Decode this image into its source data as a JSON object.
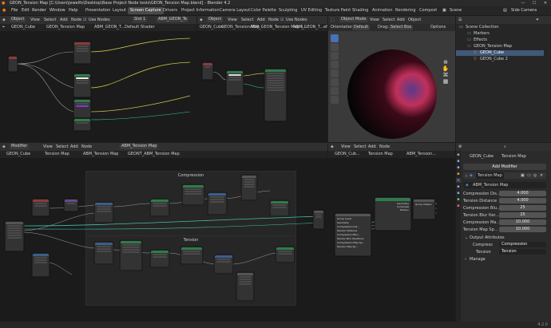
{
  "window": {
    "title": "GEON_Tension Map [C:\\Users\\jewelfo\\Desktop\\Base Project Node tests\\GEON_Tension Map.blend] - Blender 4.2",
    "minimize": "—",
    "maximize": "☐",
    "close": "✕"
  },
  "menu": {
    "items": [
      "File",
      "Edit",
      "Render",
      "Window",
      "Help"
    ],
    "workspaces": [
      "Presentation",
      "Layout",
      "Screen Capture",
      "Drivers",
      "Project Information",
      "Camera Layout",
      "Color Palette",
      "Sculpting",
      "UV Editing",
      "Texture Paint",
      "Shading",
      "Animation",
      "Rendering",
      "Compost"
    ],
    "active_workspace": "Screen Capture",
    "scene_label": "Scene",
    "view_layer_label": "Side Camera"
  },
  "shader_left": {
    "header": [
      "Object",
      "View",
      "Select",
      "Add",
      "Node",
      "Use Nodes",
      "Slot 1",
      "ABM_GEON_Te"
    ],
    "breadcrumb": [
      "GEON_Cube",
      "GEON_Tension Map",
      "ABM_GEON_T...Default Shader"
    ]
  },
  "shader_mid": {
    "header": [
      "Object",
      "View",
      "Select",
      "Add",
      "Node",
      "Use Nodes"
    ],
    "breadcrumb": [
      "GEON_Cube",
      "GEON_Tension Map",
      "ABM_GEON_Tension Map S...",
      "ABM_GEON_T...efault Shader"
    ]
  },
  "viewport": {
    "header": [
      "Object Mode",
      "View",
      "Select",
      "Add",
      "Object"
    ],
    "sub": [
      "Orientation:",
      "Default",
      "Drag:",
      "Select Box",
      "Options"
    ]
  },
  "outliner": {
    "title": "Scene Collection",
    "rows": [
      "Markers",
      "Effects",
      "GEON_Tension Map",
      "GEON_Cube",
      "GEON_Cube 2"
    ]
  },
  "geo_left": {
    "header": [
      "Modifier",
      "View",
      "Select",
      "Add",
      "Node",
      "ABM_Tension Map"
    ],
    "breadcrumb": [
      "GEON_Cube",
      "Tension Map",
      "ABM_Tension Map",
      "GEONT_ABM_Tension Map"
    ],
    "frame_top": "Compression",
    "frame_bottom": "Tension"
  },
  "geo_right": {
    "header": [
      "View",
      "Select",
      "Add",
      "Node"
    ],
    "breadcrumb": [
      "GEON_Cub...",
      "Tension Map",
      "ABM_Tension..."
    ],
    "group_output_label": "Group Output",
    "group_input_label": "Group Input",
    "outputs": [
      "Geometry",
      "Compress",
      "Tension"
    ],
    "inputs": [
      "Geometry",
      "Compression Dis...",
      "Tension Distance",
      "Compression Blur...",
      "Tension Blur Iterations",
      "Compression Map Sp...",
      "Tension Map Sp..."
    ]
  },
  "properties": {
    "breadcrumb": [
      "GEON_Cube",
      "Tension Map"
    ],
    "add_modifier": "Add Modifier",
    "modifier_name": "Tension Map",
    "node_group": "ABM_Tension Map",
    "fields": [
      {
        "label": "Compression Dis...",
        "value": "4.000"
      },
      {
        "label": "Tension Distance",
        "value": "4.000"
      },
      {
        "label": "Compression Blu...",
        "value": "25"
      },
      {
        "label": "Tension Blur Iter...",
        "value": "25"
      },
      {
        "label": "Compression Ma...",
        "value": "10.000"
      },
      {
        "label": "Tension Map Sp...",
        "value": "10.000"
      }
    ],
    "output_attributes_label": "Output Attributes",
    "outputs": [
      {
        "label": "Compress",
        "value": "Compression"
      },
      {
        "label": "Tension",
        "value": "Tension"
      }
    ],
    "manage_label": "Manage"
  },
  "status": {
    "version": "4.2.0"
  },
  "colors": {
    "accent": "#4772b3",
    "header": "#303030",
    "node_green": "#2f7b4c",
    "node_blue": "#3b5e8c",
    "node_purple": "#6a4a8a",
    "node_red": "#8c3b3b",
    "wire_yellow": "#c8c04a",
    "wire_teal": "#3fc0a8",
    "wire_gray": "#a0a0a0"
  }
}
